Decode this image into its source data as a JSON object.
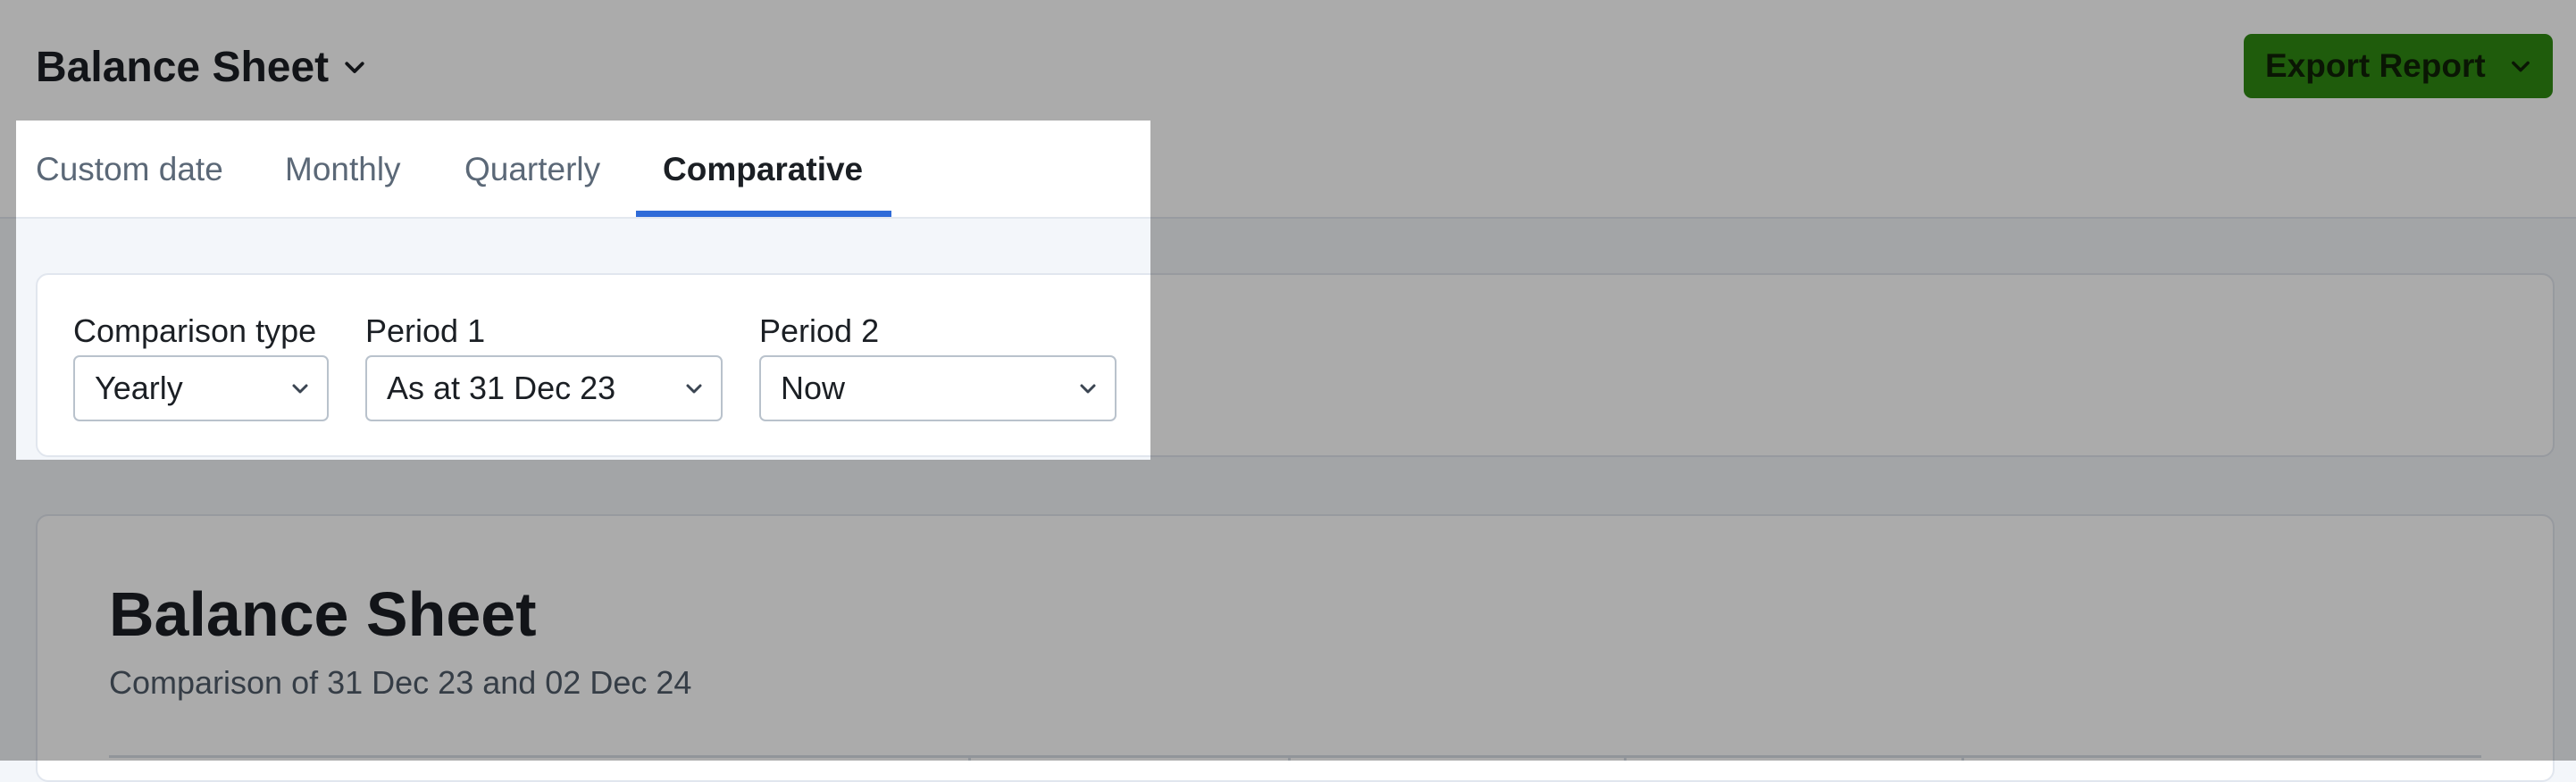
{
  "header": {
    "title": "Balance Sheet",
    "export_label": "Export Report"
  },
  "tabs": [
    {
      "label": "Custom date",
      "active": false
    },
    {
      "label": "Monthly",
      "active": false
    },
    {
      "label": "Quarterly",
      "active": false
    },
    {
      "label": "Comparative",
      "active": true
    }
  ],
  "filters": {
    "comparison_type": {
      "label": "Comparison type",
      "value": "Yearly"
    },
    "period_1": {
      "label": "Period 1",
      "value": "As at 31 Dec 23"
    },
    "period_2": {
      "label": "Period 2",
      "value": "Now"
    }
  },
  "report": {
    "title": "Balance Sheet",
    "subtitle": "Comparison of 31 Dec 23 and 02 Dec 24"
  },
  "colors": {
    "accent": "#2f6bd8",
    "export_button": "#2f8a12",
    "overlay": "rgba(0,0,0,0.33)"
  }
}
